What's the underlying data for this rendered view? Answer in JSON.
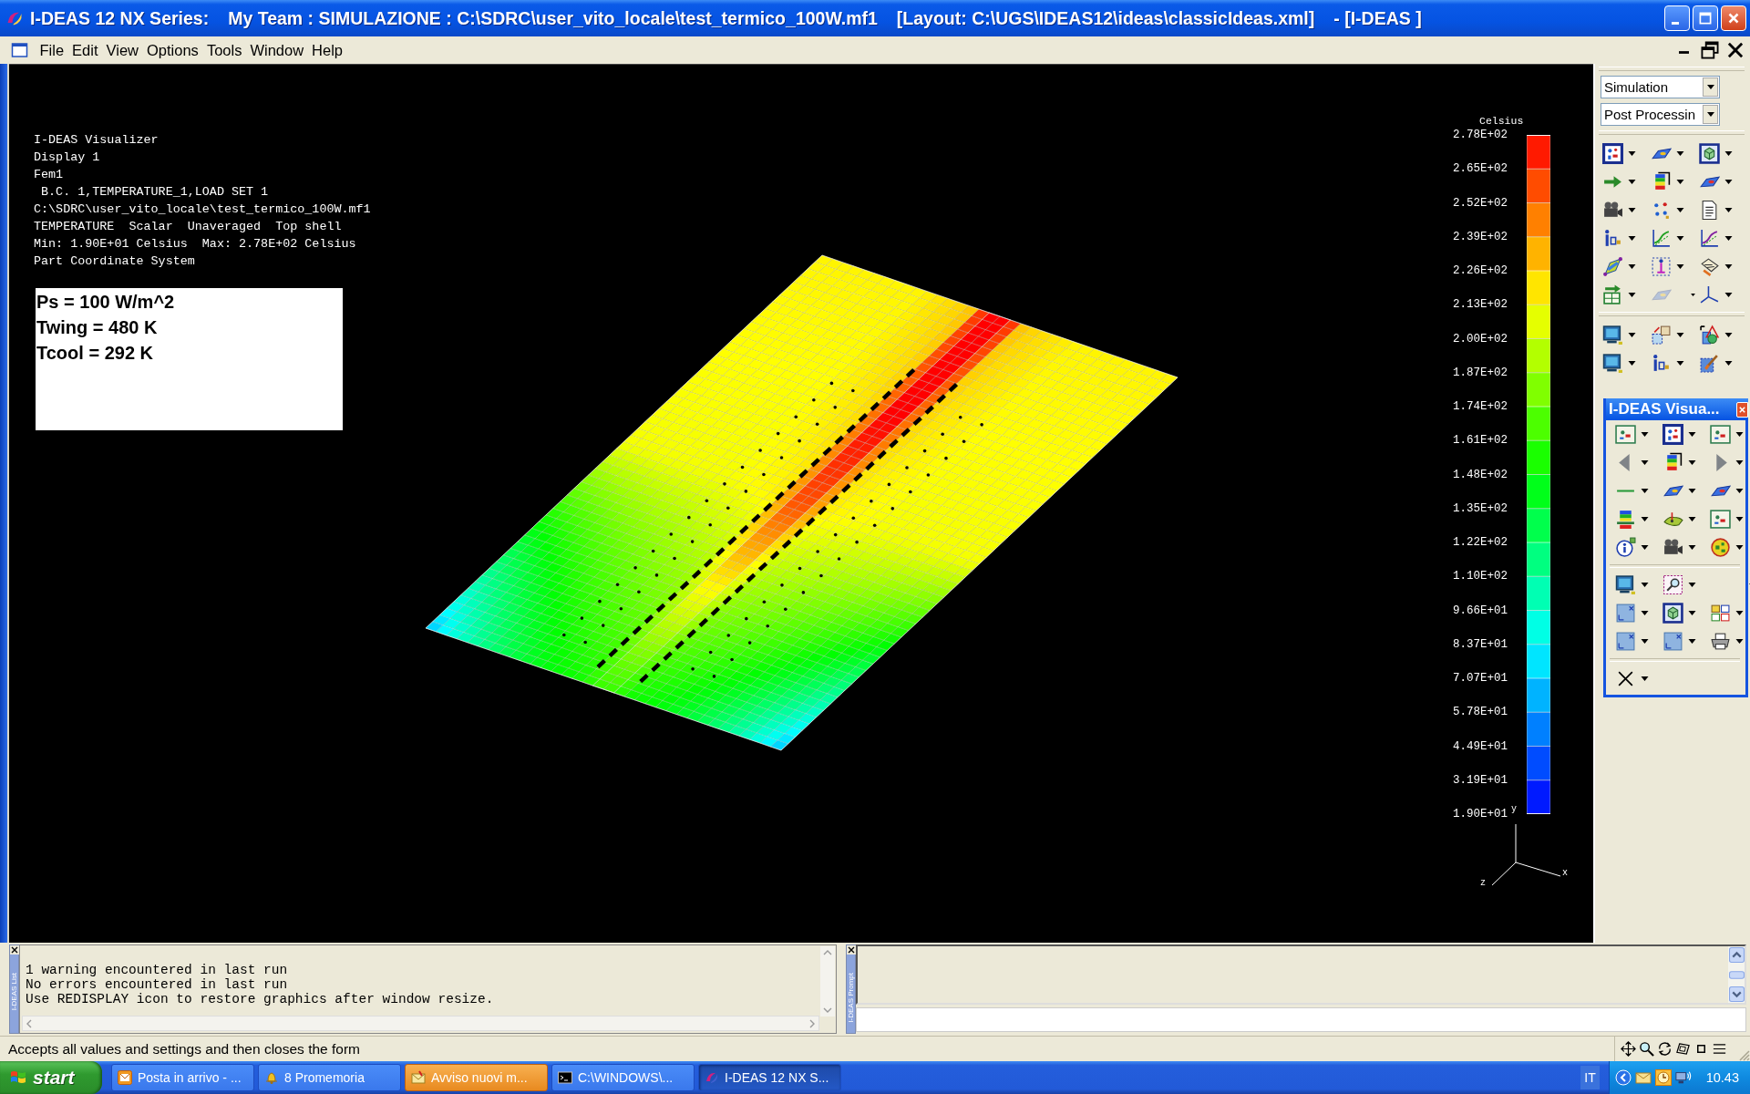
{
  "window": {
    "title_parts": [
      "I-DEAS 12 NX Series:",
      "My Team : SIMULAZIONE : C:\\SDRC\\user_vito_locale\\test_termico_100W.mf1",
      "[Layout: C:\\UGS\\IDEAS12\\ideas\\classicIdeas.xml]",
      "- [I-DEAS ]"
    ]
  },
  "menu_bar": {
    "items": [
      "File",
      "Edit",
      "View",
      "Options",
      "Tools",
      "Window",
      "Help"
    ]
  },
  "viewport": {
    "info_lines": [
      "I-DEAS Visualizer",
      "Display 1",
      "Fem1",
      " B.C. 1,TEMPERATURE_1,LOAD SET 1",
      "C:\\SDRC\\user_vito_locale\\test_termico_100W.mf1",
      "TEMPERATURE  Scalar  Unaveraged  Top shell",
      "Min: 1.90E+01 Celsius  Max: 2.78E+02 Celsius",
      "Part Coordinate System"
    ],
    "note_box": {
      "lines": [
        "Ps = 100 W/m^2",
        "Twing = 480 K",
        "Tcool = 292 K"
      ]
    },
    "legend": {
      "title": "Celsius",
      "labels": [
        "2.78E+02",
        "2.65E+02",
        "2.52E+02",
        "2.39E+02",
        "2.26E+02",
        "2.13E+02",
        "2.00E+02",
        "1.87E+02",
        "1.74E+02",
        "1.61E+02",
        "1.48E+02",
        "1.35E+02",
        "1.22E+02",
        "1.10E+02",
        "9.66E+01",
        "8.37E+01",
        "7.07E+01",
        "5.78E+01",
        "4.49E+01",
        "3.19E+01",
        "1.90E+01"
      ]
    },
    "axis_triad": {
      "labels": [
        "y",
        "x",
        "z"
      ]
    }
  },
  "side_panel": {
    "dropdowns": [
      {
        "value": "Simulation"
      },
      {
        "value": "Post Processin"
      }
    ],
    "toolbar_groups": [
      {
        "buttons": [
          {
            "disabled": false
          },
          {
            "disabled": false
          },
          {
            "disabled": false
          },
          {
            "disabled": false
          },
          {
            "disabled": false
          },
          {
            "disabled": false
          },
          {
            "disabled": false
          },
          {
            "disabled": false
          },
          {
            "disabled": false
          },
          {
            "disabled": false
          },
          {
            "disabled": false
          },
          {
            "disabled": false
          },
          {
            "disabled": false
          },
          {
            "disabled": false
          },
          {
            "disabled": false
          },
          {
            "disabled": false
          },
          {
            "disabled": true
          },
          {
            "disabled": false
          }
        ]
      },
      {
        "buttons": [
          {
            "disabled": false
          },
          {
            "disabled": false
          },
          {
            "disabled": false
          },
          {
            "disabled": false
          },
          {
            "disabled": false
          },
          {
            "disabled": false
          }
        ]
      }
    ]
  },
  "floating_toolbar": {
    "title": "I-DEAS Visua..."
  },
  "list_panel": {
    "tab_label": "I-DEAS List",
    "lines": [
      "1 warning encountered in last run",
      "No errors encountered in last run",
      "Use REDISPLAY icon to restore graphics after window resize."
    ]
  },
  "prompt_panel": {
    "tab_label": "I-DEAS Prompt"
  },
  "status_bar": {
    "message": "Accepts all values and settings and then closes the form"
  },
  "taskbar": {
    "start_label": "start",
    "tasks": [
      {
        "label": "Posta in arrivo - ...",
        "selected": false,
        "flashing": false
      },
      {
        "label": "8 Promemoria",
        "selected": false,
        "flashing": false
      },
      {
        "label": "Avviso nuovi m...",
        "selected": false,
        "flashing": true
      },
      {
        "label": "C:\\WINDOWS\\...",
        "selected": false,
        "flashing": false
      },
      {
        "label": "I-DEAS 12 NX S...",
        "selected": true,
        "flashing": false
      }
    ],
    "tray": {
      "language": "IT",
      "clock": "10.43"
    }
  }
}
